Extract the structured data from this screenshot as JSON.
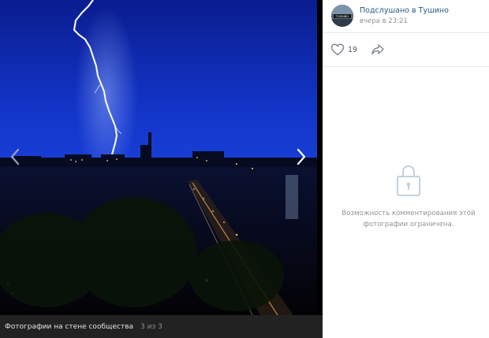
{
  "post": {
    "author": "Подслушано в Тушино",
    "time": "вчера в 23:21",
    "avatar_text": "TUSHINO",
    "likes": "19"
  },
  "footer": {
    "title": "Фотографии на стене сообщества",
    "counter": "3 из 3"
  },
  "comments": {
    "restricted_line1": "Возможность комментирования этой",
    "restricted_line2": "фотографии ограничена."
  },
  "icons": {
    "prev": "chevron-left-icon",
    "next": "chevron-right-icon",
    "like": "heart-icon",
    "share": "share-arrow-icon",
    "lock": "lock-icon"
  },
  "colors": {
    "link": "#2a5885",
    "muted": "#939393",
    "footer_bg": "#222222",
    "sky": "#0b1f9c"
  }
}
